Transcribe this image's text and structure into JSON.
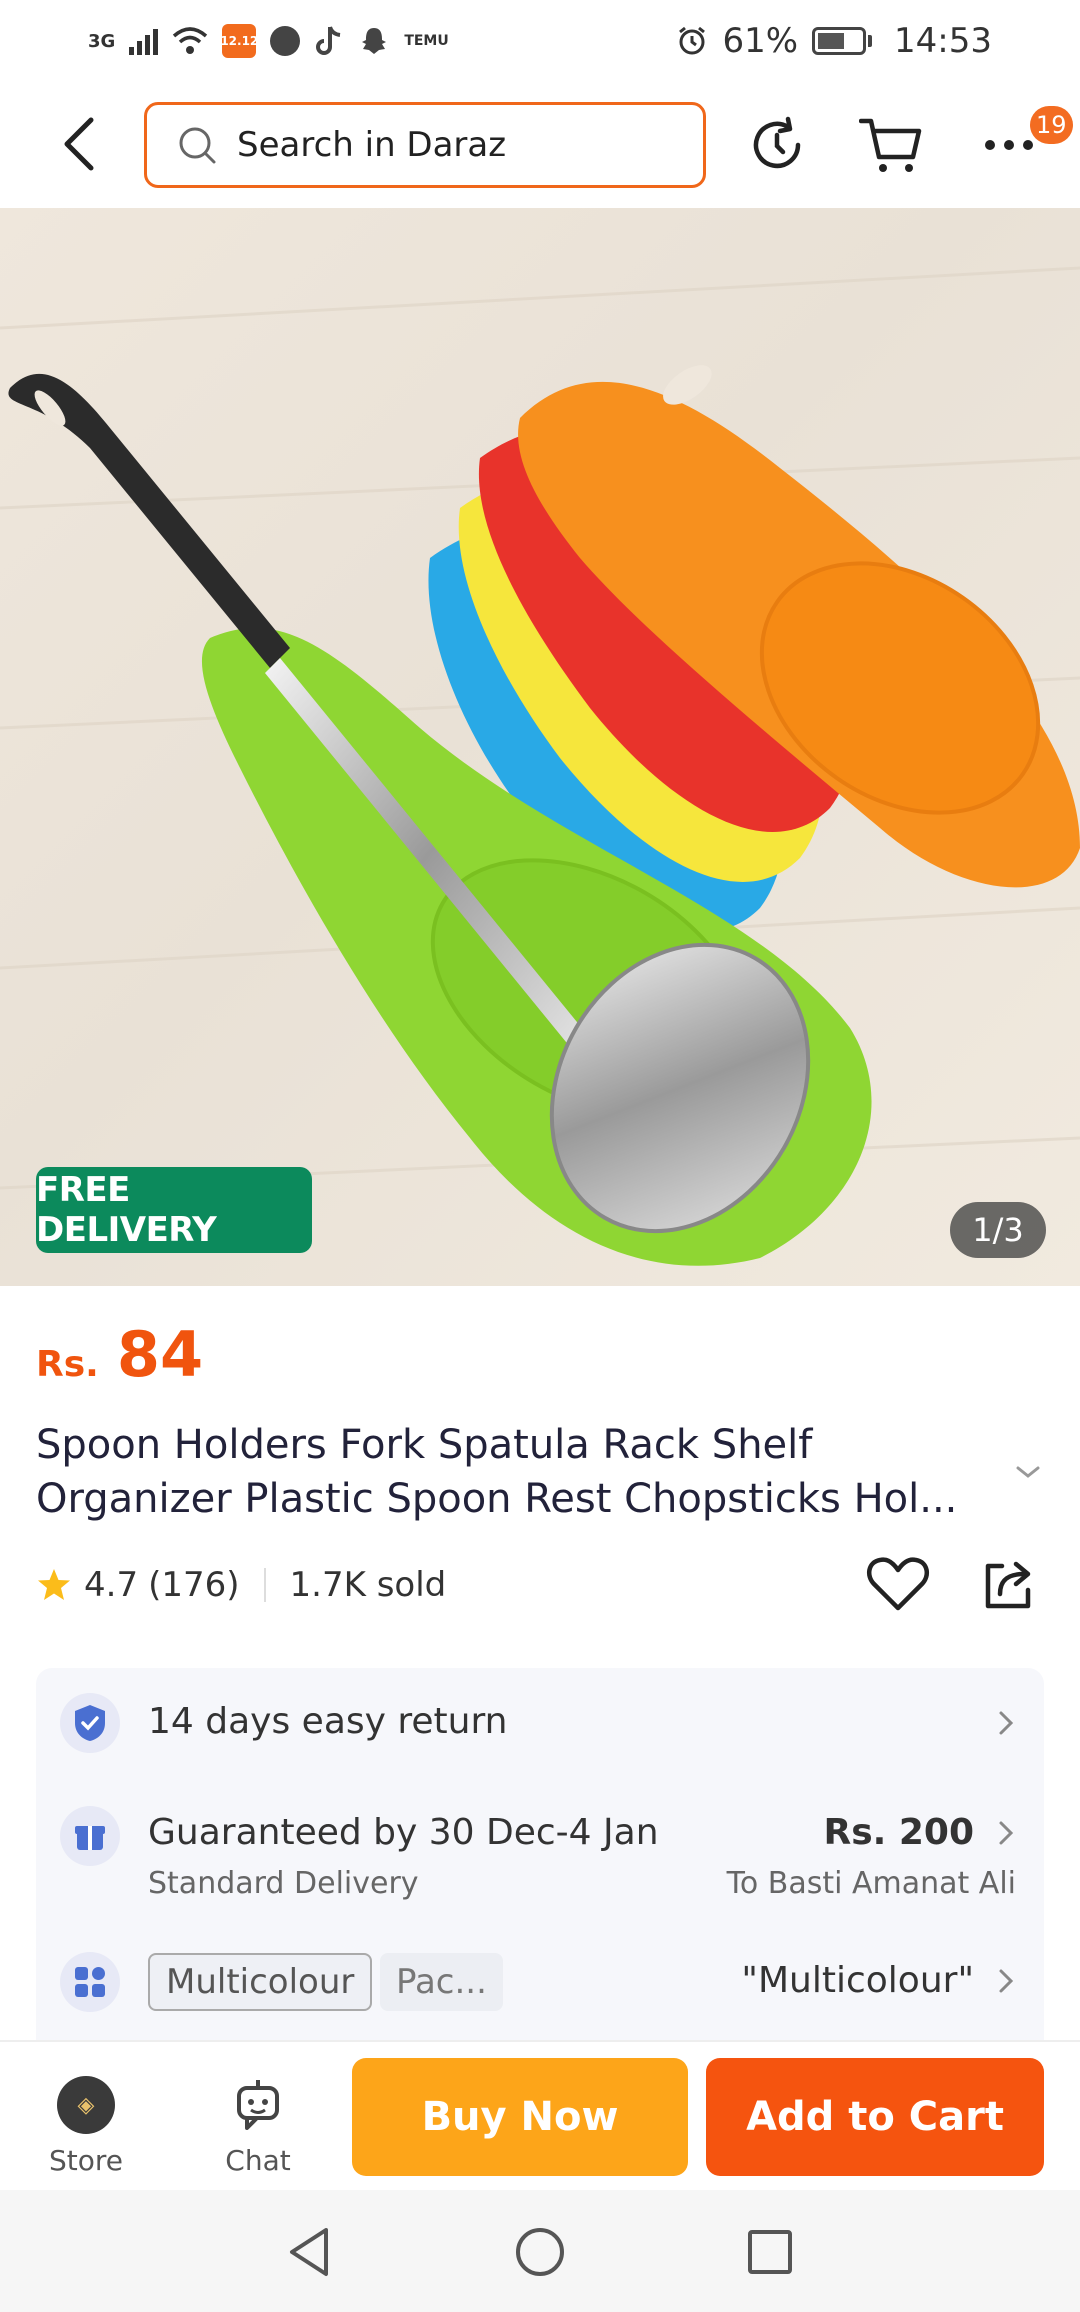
{
  "status_bar": {
    "network": "3G",
    "battery_percent": "61%",
    "time": "14:53",
    "temu_label": "TEMU"
  },
  "header": {
    "search_placeholder": "Search in Daraz",
    "more_badge": "19"
  },
  "product": {
    "image_badge": "FREE DELIVERY",
    "image_counter": "1/3",
    "price_currency": "Rs.",
    "price_value": "84",
    "title": "Spoon Holders Fork Spatula Rack Shelf Organizer Plastic Spoon Rest Chopsticks Hol...",
    "rating": "4.7",
    "reviews": "(176)",
    "sold": "1.7K sold"
  },
  "info": {
    "return_text": "14 days easy return",
    "delivery_text": "Guaranteed by 30 Dec-4 Jan",
    "delivery_sub": "Standard Delivery",
    "delivery_price": "Rs. 200",
    "delivery_to": "To Basti Amanat Ali",
    "variant_chip_1": "Multicolour",
    "variant_chip_2": "Pac...",
    "variant_selected": "\"Multicolour\""
  },
  "actions": {
    "store_label": "Store",
    "chat_label": "Chat",
    "buy_now": "Buy Now",
    "add_to_cart": "Add to Cart"
  },
  "colors": {
    "brand_orange": "#f5540f",
    "buy_now_yellow": "#fda519",
    "free_delivery_green": "#0c8a5c"
  }
}
